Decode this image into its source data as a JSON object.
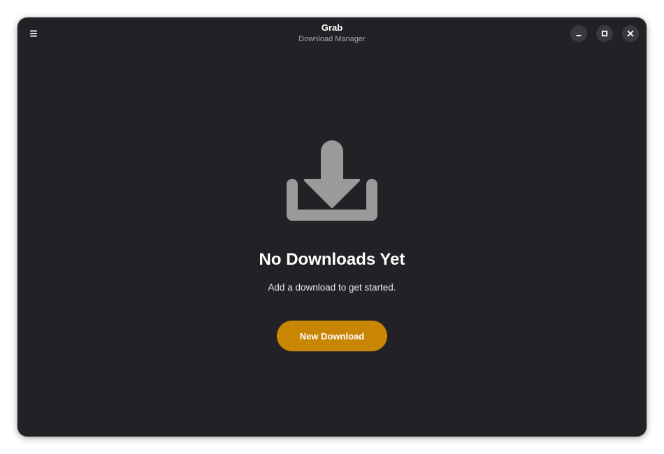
{
  "window": {
    "title": "Grab",
    "subtitle": "Download Manager"
  },
  "headerbar": {
    "menu_icon": "hamburger-menu-icon",
    "controls": [
      {
        "name": "minimize",
        "icon": "minimize-icon"
      },
      {
        "name": "maximize",
        "icon": "maximize-icon"
      },
      {
        "name": "close",
        "icon": "close-icon"
      }
    ]
  },
  "empty_state": {
    "icon": "download-icon",
    "title": "No Downloads Yet",
    "description": "Add a download to get started.",
    "button_label": "New Download"
  },
  "colors": {
    "background": "#222226",
    "accent": "#c98504",
    "icon": "#9a9a9a",
    "subtitle": "#a8a8ad"
  }
}
